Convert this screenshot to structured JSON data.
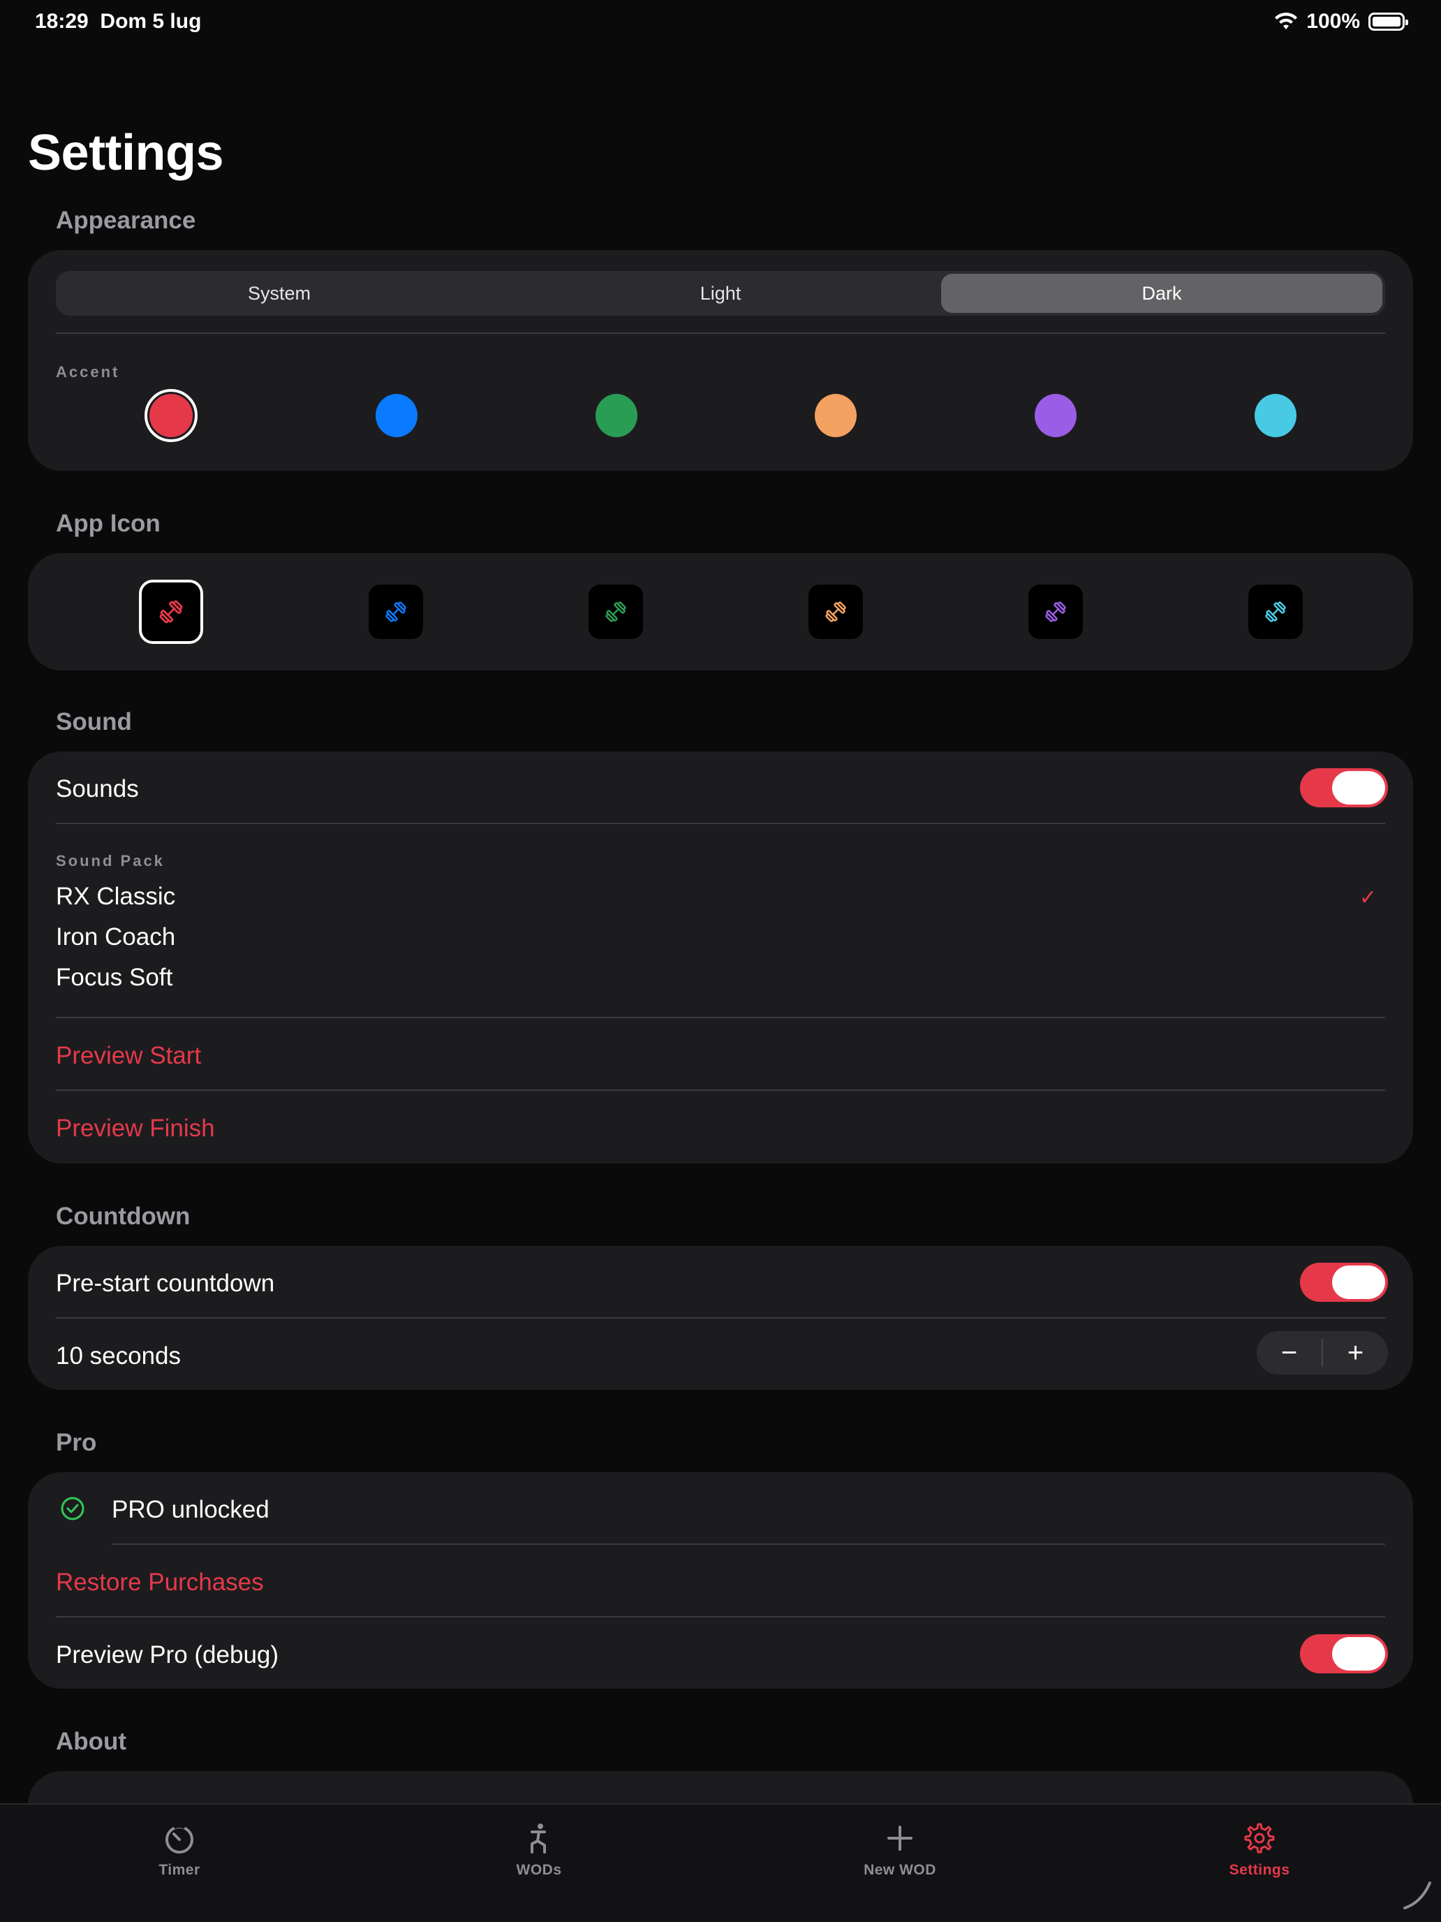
{
  "status_bar": {
    "time": "18:29",
    "date": "Dom 5 lug",
    "battery": "100%"
  },
  "page": {
    "title": "Settings"
  },
  "appearance": {
    "title": "Appearance",
    "modes": [
      "System",
      "Light",
      "Dark"
    ],
    "selected_mode": "Dark",
    "accent_label": "Accent",
    "accents": [
      "#e5394a",
      "#0a7aff",
      "#2a9d55",
      "#f4a261",
      "#9b5de5",
      "#48cae4"
    ],
    "selected_accent": 0
  },
  "app_icon": {
    "title": "App Icon",
    "icons": [
      "#e5394a",
      "#0a7aff",
      "#2a9d55",
      "#f4a261",
      "#9b5de5",
      "#48cae4"
    ],
    "selected": 0
  },
  "sound": {
    "title": "Sound",
    "sounds_label": "Sounds",
    "sounds_on": true,
    "pack_label": "Sound Pack",
    "packs": [
      "RX Classic",
      "Iron Coach",
      "Focus Soft"
    ],
    "selected_pack": "RX Classic",
    "preview_start": "Preview Start",
    "preview_finish": "Preview Finish"
  },
  "countdown": {
    "title": "Countdown",
    "prestart_label": "Pre-start countdown",
    "prestart_on": true,
    "duration_label": "10 seconds",
    "minus": "−",
    "plus": "+"
  },
  "pro": {
    "title": "Pro",
    "unlocked_label": "PRO unlocked",
    "restore_label": "Restore Purchases",
    "debug_label": "Preview Pro (debug)",
    "debug_on": true
  },
  "about": {
    "title": "About"
  },
  "tabs": [
    {
      "label": "Timer"
    },
    {
      "label": "WODs"
    },
    {
      "label": "New WOD"
    },
    {
      "label": "Settings"
    }
  ],
  "colors": {
    "accent": "#e5394a",
    "card": "#1c1c1e",
    "background": "#0a0a0b",
    "success": "#34c759"
  }
}
